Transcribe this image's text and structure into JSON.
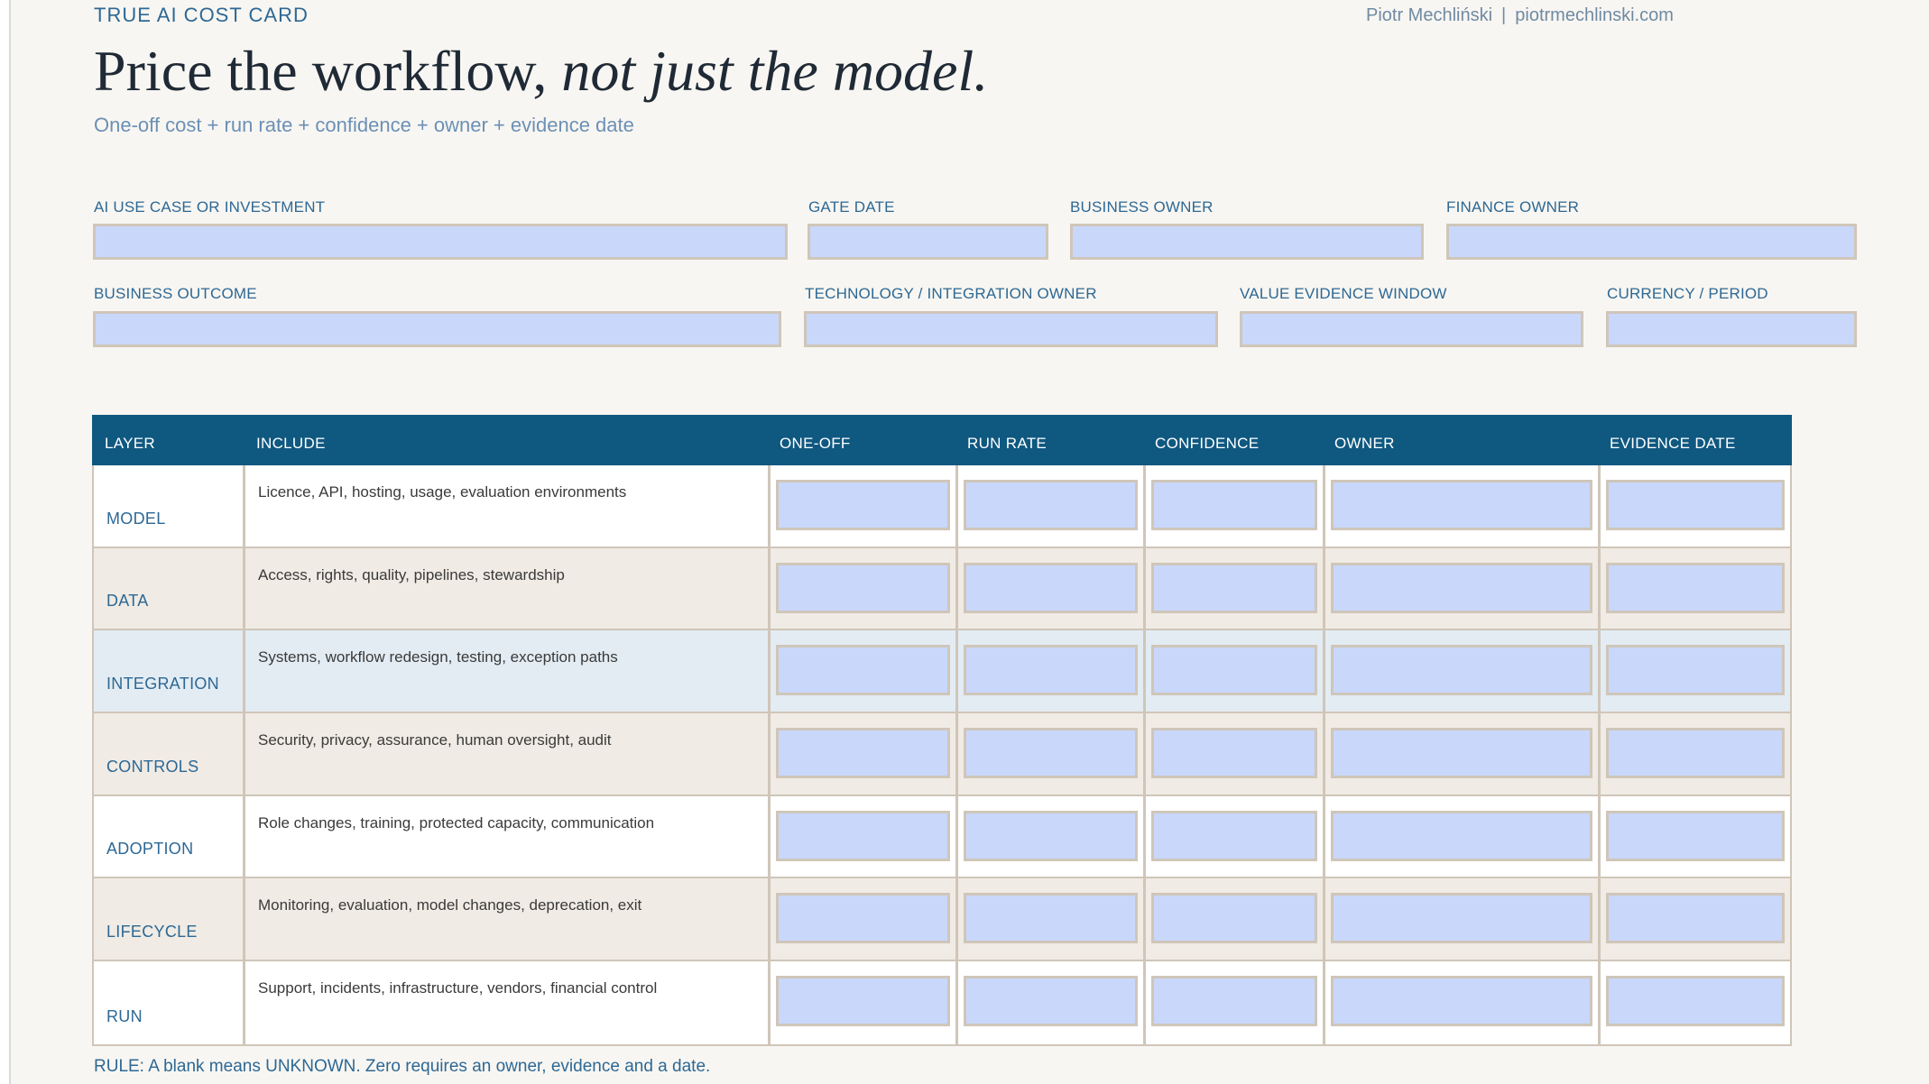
{
  "kicker": "TRUE AI COST CARD",
  "byline": {
    "author": "Piotr Mechliński",
    "separator": "|",
    "site": "piotrmechlinski.com"
  },
  "title": {
    "regular": "Price the workflow,",
    "italic": "not just the model."
  },
  "subtitle": "One-off cost + run rate + confidence + owner + evidence date",
  "fields": {
    "use_case": {
      "label": "AI USE CASE OR INVESTMENT",
      "value": ""
    },
    "gate_date": {
      "label": "GATE DATE",
      "value": ""
    },
    "business_owner": {
      "label": "BUSINESS OWNER",
      "value": ""
    },
    "finance_owner": {
      "label": "FINANCE OWNER",
      "value": ""
    },
    "business_outcome": {
      "label": "BUSINESS OUTCOME",
      "value": ""
    },
    "tech_owner": {
      "label": "TECHNOLOGY / INTEGRATION OWNER",
      "value": ""
    },
    "value_window": {
      "label": "VALUE EVIDENCE WINDOW",
      "value": ""
    },
    "currency_period": {
      "label": "CURRENCY / PERIOD",
      "value": ""
    }
  },
  "table": {
    "headers": [
      "LAYER",
      "INCLUDE",
      "ONE-OFF",
      "RUN RATE",
      "CONFIDENCE",
      "OWNER",
      "EVIDENCE DATE"
    ],
    "rows": [
      {
        "layer": "MODEL",
        "include": "Licence, API, hosting, usage, evaluation environments",
        "bg": "#ffffff"
      },
      {
        "layer": "DATA",
        "include": "Access, rights, quality, pipelines, stewardship",
        "bg": "#f0ebe4"
      },
      {
        "layer": "INTEGRATION",
        "include": "Systems, workflow redesign, testing, exception paths",
        "bg": "#e3ecf3"
      },
      {
        "layer": "CONTROLS",
        "include": "Security, privacy, assurance, human oversight, audit",
        "bg": "#f0ebe4"
      },
      {
        "layer": "ADOPTION",
        "include": "Role changes, training, protected capacity, communication",
        "bg": "#ffffff"
      },
      {
        "layer": "LIFECYCLE",
        "include": "Monitoring, evaluation, model changes, deprecation, exit",
        "bg": "#f0ebe4"
      },
      {
        "layer": "RUN",
        "include": "Support, incidents, infrastructure, vendors, financial control",
        "bg": "#ffffff"
      }
    ]
  },
  "rule_note": "RULE: A blank means UNKNOWN. Zero requires an owner, evidence and a date.",
  "colors": {
    "header_bg": "#0f5880",
    "input_fill": "#c9d7fb",
    "accent_text": "#2d6894",
    "border": "#cfc6b9"
  }
}
